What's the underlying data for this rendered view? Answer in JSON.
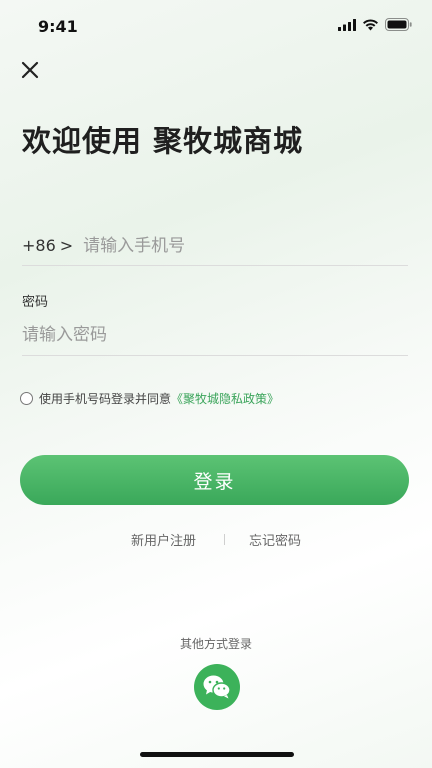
{
  "status_bar": {
    "time": "9:41"
  },
  "header": {
    "title": "欢迎使用 聚牧城商城"
  },
  "phone": {
    "country_code": "+86",
    "chevron": ">",
    "placeholder": "请输入手机号"
  },
  "password": {
    "label": "密码",
    "placeholder": "请输入密码"
  },
  "agreement": {
    "text": "使用手机号码登录并同意",
    "policy": "《聚牧城隐私政策》",
    "checked": false
  },
  "login_button": {
    "label": "登录"
  },
  "links": {
    "register": "新用户注册",
    "forgot": "忘记密码"
  },
  "other_login": {
    "label": "其他方式登录",
    "icon": "wechat-icon"
  },
  "colors": {
    "accent": "#3aa85a",
    "link": "#3aa45a"
  }
}
